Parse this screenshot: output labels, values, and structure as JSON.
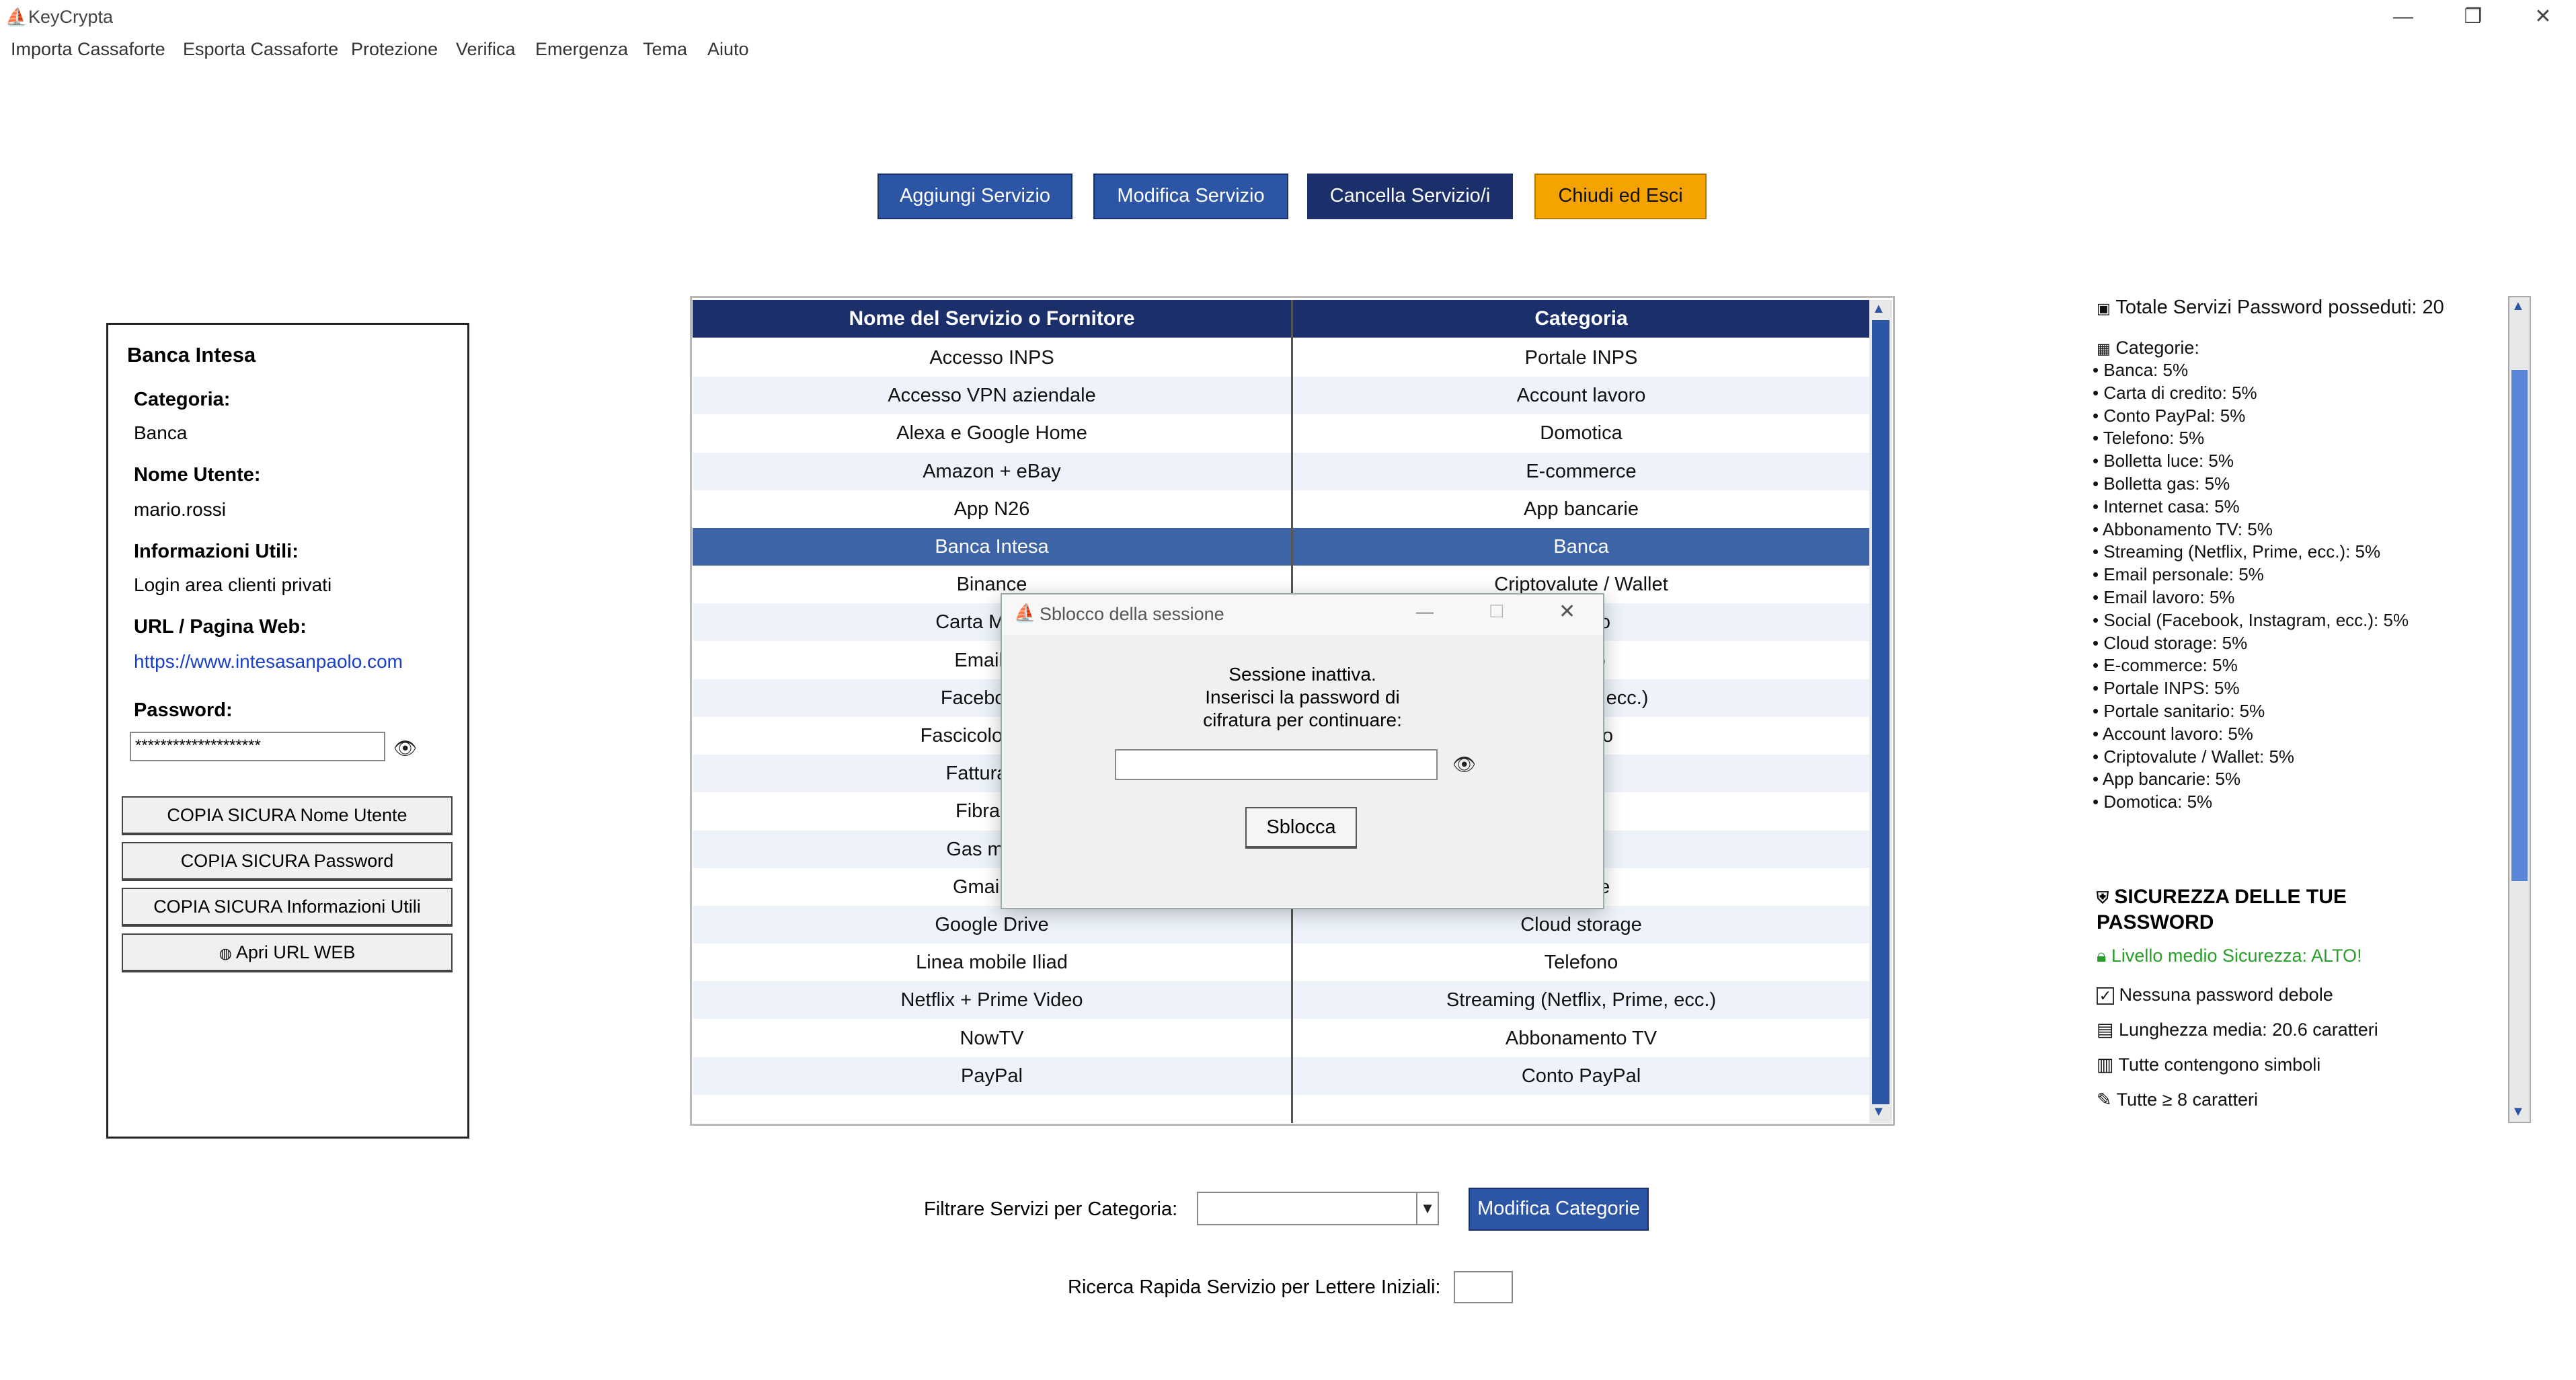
{
  "window": {
    "title": "KeyCrypta",
    "minimize": "—",
    "restore": "❐",
    "close": "✕"
  },
  "menu": [
    "Importa Cassaforte",
    "Esporta Cassaforte",
    "Protezione",
    "Verifica",
    "Emergenza",
    "Tema",
    "Aiuto"
  ],
  "toolbar": {
    "add": "Aggiungi Servizio",
    "edit": "Modifica Servizio",
    "delete": "Cancella Servizio/i",
    "exit": "Chiudi ed Esci"
  },
  "colors": {
    "accent": "#2d55a6",
    "dark_navy": "#1b2f6a",
    "exit_orange": "#f5a300",
    "selected_row": "#3e64a8",
    "alt_row": "#eef3fb",
    "secure_green": "#2a9d2a",
    "link_blue": "#1a3fc7"
  },
  "details": {
    "title": "Banca Intesa",
    "category_label": "Categoria:",
    "category": "Banca",
    "username_label": "Nome Utente:",
    "username": "mario.rossi",
    "info_label": "Informazioni Utili:",
    "info": "Login area clienti privati",
    "url_label": "URL / Pagina Web:",
    "url": "https://www.intesasanpaolo.com",
    "password_label": "Password:",
    "password_masked": "********************",
    "copy_user": "COPIA SICURA Nome Utente",
    "copy_password": "COPIA SICURA Password",
    "copy_info": "COPIA SICURA Informazioni Utili",
    "open_url": "Apri URL WEB"
  },
  "table": {
    "col_name": "Nome del Servizio o Fornitore",
    "col_category": "Categoria",
    "rows": [
      {
        "name": "Accesso INPS",
        "category": "Portale INPS"
      },
      {
        "name": "Accesso VPN aziendale",
        "category": "Account lavoro"
      },
      {
        "name": "Alexa e Google Home",
        "category": "Domotica"
      },
      {
        "name": "Amazon + eBay",
        "category": "E-commerce"
      },
      {
        "name": "App N26",
        "category": "App bancarie"
      },
      {
        "name": "Banca Intesa",
        "category": "Banca"
      },
      {
        "name": "Binance",
        "category": "Criptovalute / Wallet"
      },
      {
        "name": "Carta Master",
        "category": "credito"
      },
      {
        "name": "Email az",
        "category": "avoro"
      },
      {
        "name": "Facebook +",
        "category": "nstagram, ecc.)"
      },
      {
        "name": "Fascicolo Sanita",
        "category": "anitario"
      },
      {
        "name": "Fattura luc",
        "category": "luce"
      },
      {
        "name": "Fibra Fa",
        "category": "casa"
      },
      {
        "name": "Gas metar",
        "category": "gas"
      },
      {
        "name": "Gmail pe",
        "category": "sonale"
      },
      {
        "name": "Google Drive",
        "category": "Cloud storage"
      },
      {
        "name": "Linea mobile Iliad",
        "category": "Telefono"
      },
      {
        "name": "Netflix + Prime Video",
        "category": "Streaming (Netflix, Prime, ecc.)"
      },
      {
        "name": "NowTV",
        "category": "Abbonamento TV"
      },
      {
        "name": "PayPal",
        "category": "Conto PayPal"
      }
    ],
    "selected_index": 5
  },
  "stats": {
    "total": "Totale Servizi Password posseduti: 20",
    "categories_label": "Categorie:",
    "categories": [
      "• Banca: 5%",
      "• Carta di credito: 5%",
      "• Conto PayPal: 5%",
      "• Telefono: 5%",
      "• Bolletta luce: 5%",
      "• Bolletta gas: 5%",
      "• Internet casa: 5%",
      "• Abbonamento TV: 5%",
      "• Streaming (Netflix, Prime, ecc.): 5%",
      "• Email personale: 5%",
      "• Email lavoro: 5%",
      "• Social (Facebook, Instagram, ecc.): 5%",
      "• Cloud storage: 5%",
      "• E-commerce: 5%",
      "• Portale INPS: 5%",
      "• Portale sanitario: 5%",
      "• Account lavoro: 5%",
      "• Criptovalute / Wallet: 5%",
      "• App bancarie: 5%",
      "• Domotica: 5%"
    ],
    "security_title_1": "SICUREZZA DELLE TUE",
    "security_title_2": "PASSWORD",
    "security_level": "Livello medio Sicurezza: ALTO!",
    "no_weak": "Nessuna password debole",
    "avg_length": "Lunghezza media: 20.6 caratteri",
    "symbols": "Tutte contengono simboli",
    "min_length": "Tutte ≥ 8 caratteri"
  },
  "bottom": {
    "filter_label": "Filtrare Servizi per Categoria:",
    "filter_value": "",
    "edit_categories": "Modifica Categorie",
    "quick_search_label": "Ricerca Rapida Servizio per Lettere Iniziali:",
    "quick_search_value": ""
  },
  "dialog": {
    "title": "Sblocco della sessione",
    "line1": "Sessione inattiva.",
    "line2": "Inserisci la password di",
    "line3": "cifratura per continuare:",
    "password_value": "",
    "unlock": "Sblocca",
    "minimize": "—",
    "maximize": "☐",
    "close": "✕"
  }
}
